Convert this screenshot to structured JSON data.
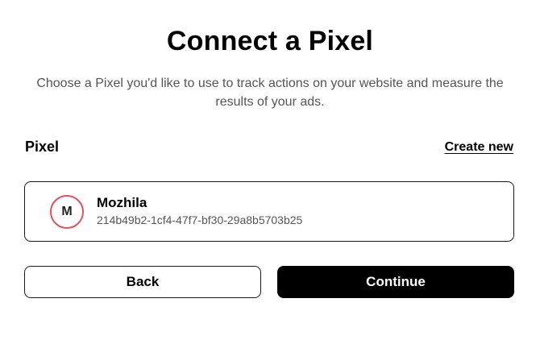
{
  "header": {
    "title": "Connect a Pixel",
    "subtitle": "Choose a Pixel you'd like to use to track actions on your website and measure the results of your ads."
  },
  "pixel_section": {
    "label": "Pixel",
    "create_link": "Create new",
    "selected_pixel": {
      "avatar_initial": "M",
      "avatar_border_color": "#e0525e",
      "name": "Mozhila",
      "id": "214b49b2-1cf4-47f7-bf30-29a8b5703b25"
    }
  },
  "actions": {
    "back_label": "Back",
    "continue_label": "Continue"
  }
}
